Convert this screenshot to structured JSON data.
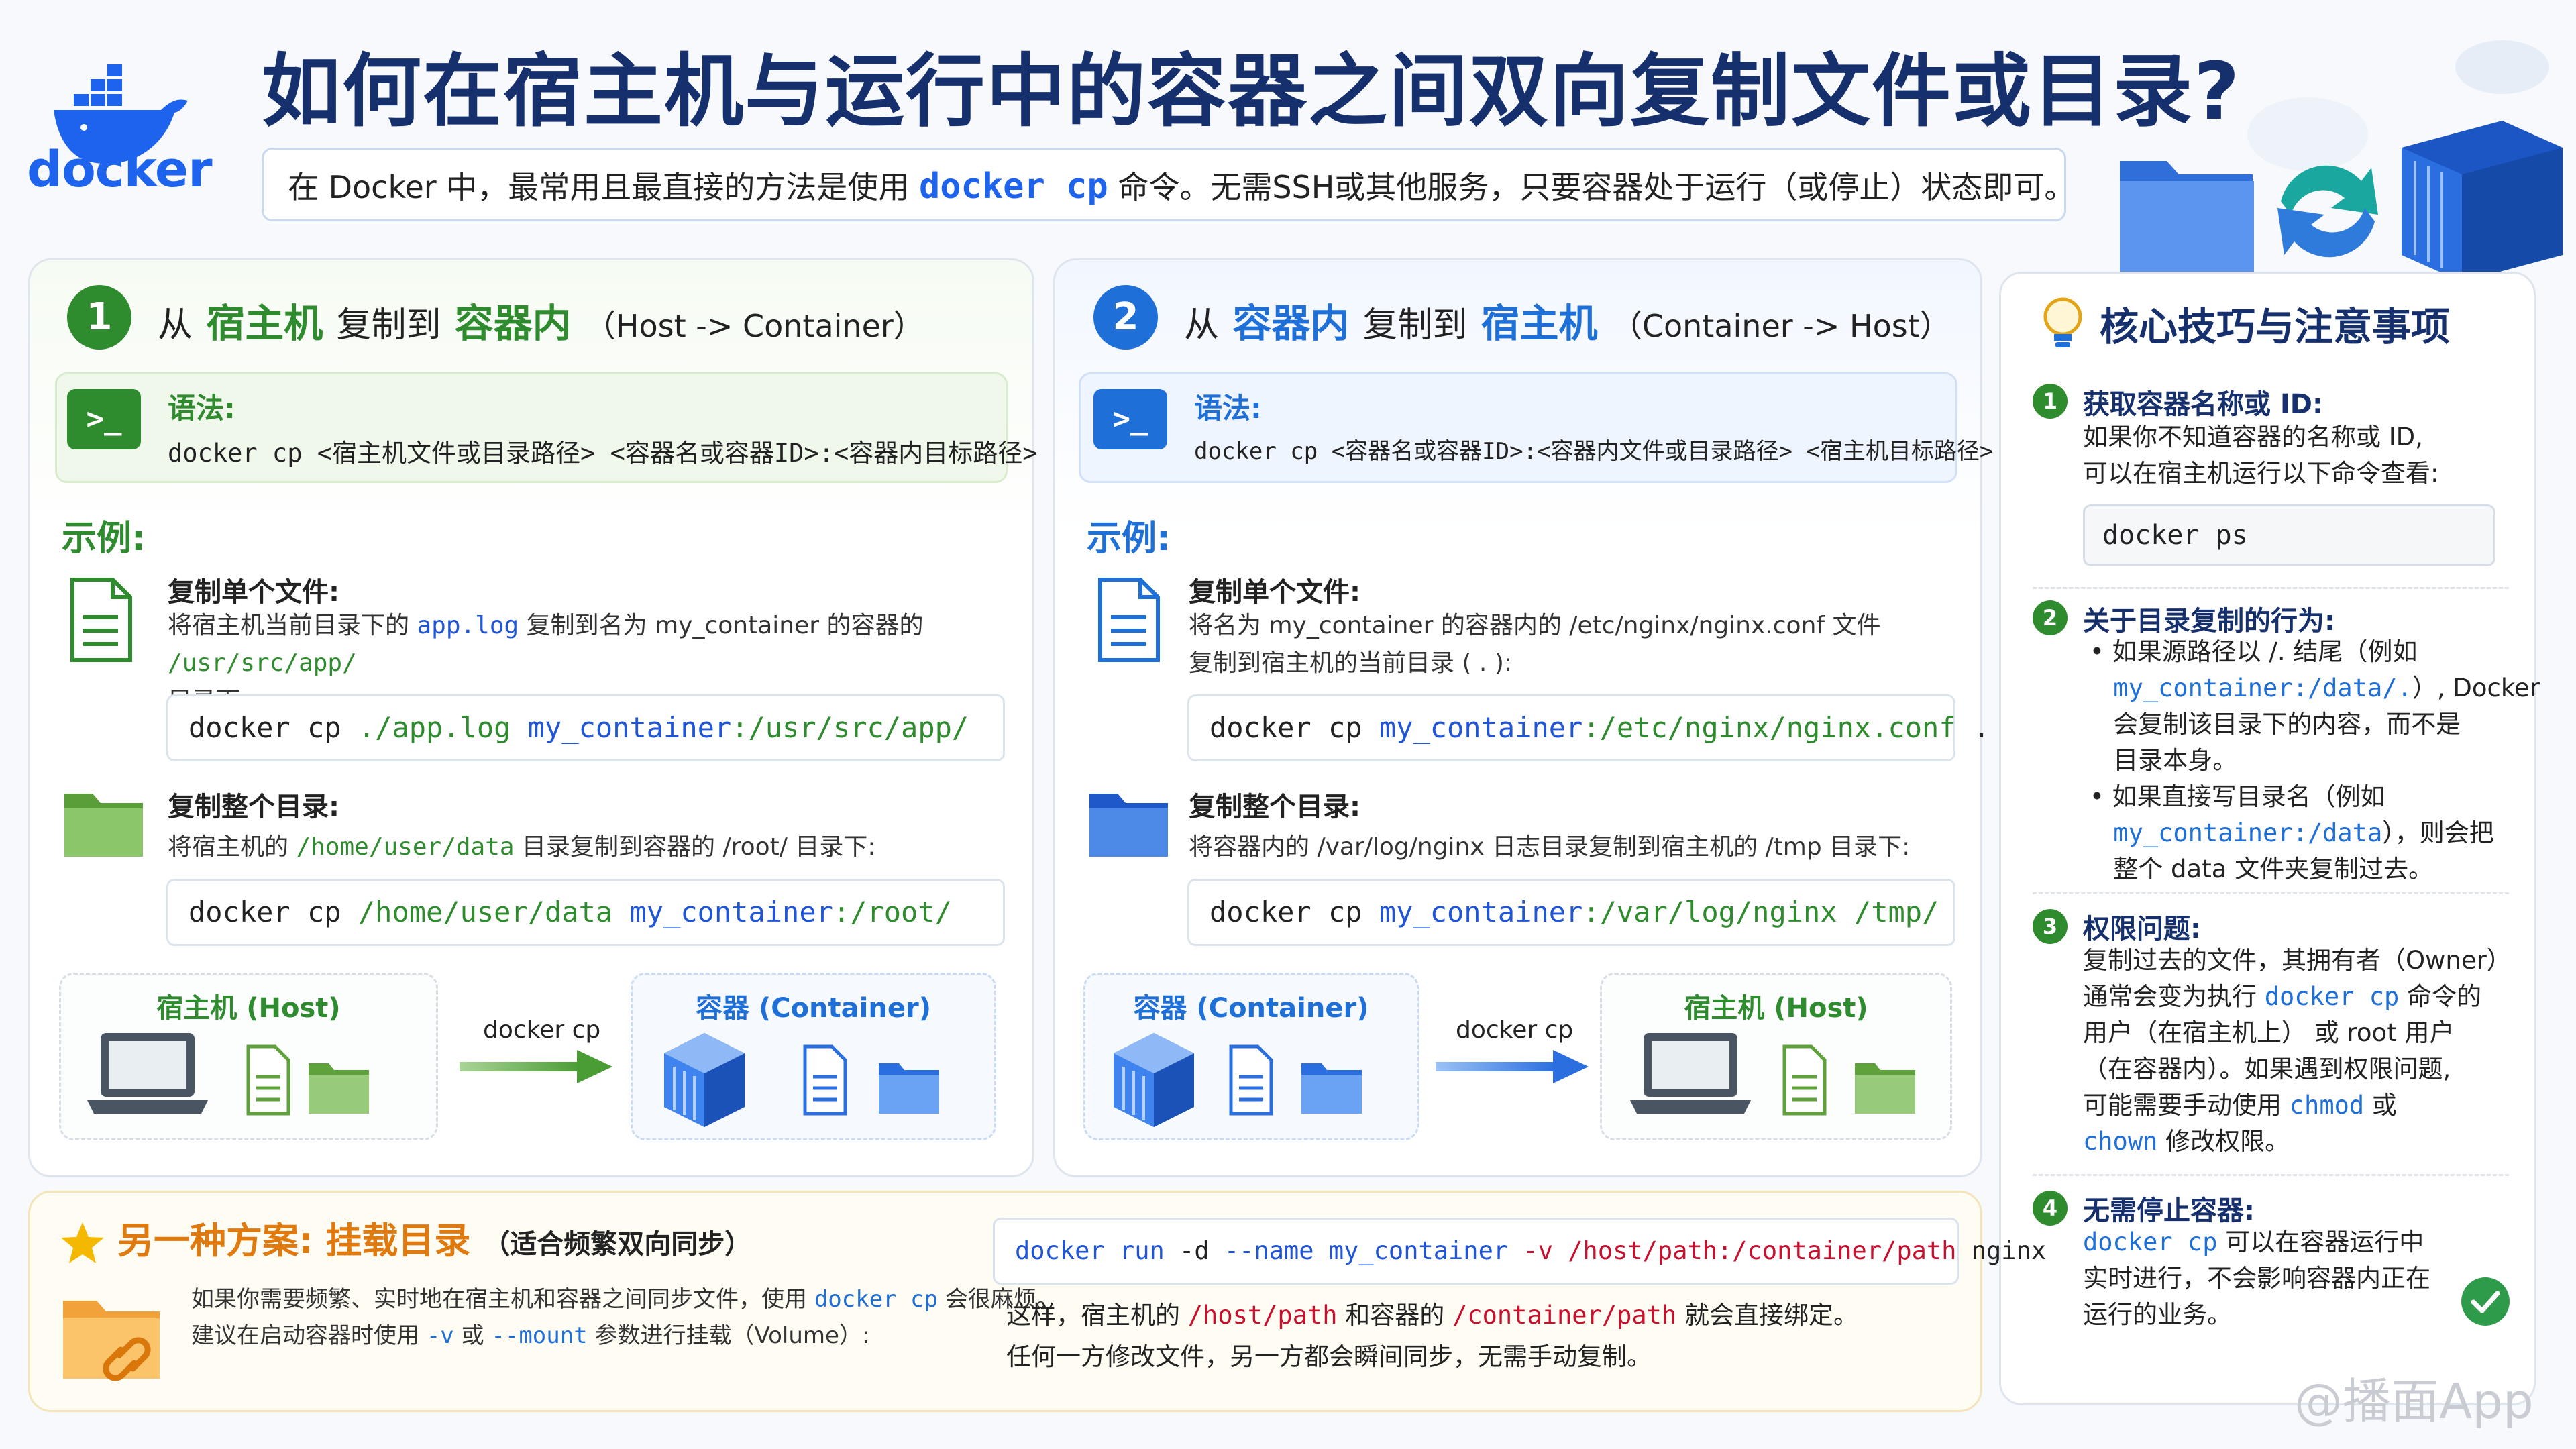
{
  "header": {
    "logo_text": "docker",
    "title": "如何在宿主机与运行中的容器之间双向复制文件或目录?",
    "intro_prefix": "在 Docker 中，最常用且最直接的方法是使用",
    "intro_cmd": "docker cp",
    "intro_suffix": "命令。无需SSH或其他服务，只要容器处于运行（或停止）状态即可。"
  },
  "section1": {
    "number": "1",
    "from": "从",
    "src": "宿主机",
    "copy_to": "复制到",
    "dst": "容器内",
    "direction": "（Host -> Container）",
    "syntax_label": "语法:",
    "syntax": "docker cp <宿主机文件或目录路径> <容器名或容器ID>:<容器内目标路径>",
    "examples_label": "示例:",
    "ex1_title": "复制单个文件:",
    "ex1_desc_a": "将宿主机当前目录下的",
    "ex1_desc_file": "app.log",
    "ex1_desc_b": "复制到名为 my_container 的容器的",
    "ex1_desc_path": "/usr/src/app/",
    "ex1_desc_c": "目录下:",
    "ex1_cmd_a": "docker cp",
    "ex1_cmd_b": "./app.log",
    "ex1_cmd_c": "my_container",
    "ex1_cmd_d": ":/usr/src/app/",
    "ex2_title": "复制整个目录:",
    "ex2_desc_a": "将宿主机的",
    "ex2_desc_path": "/home/user/data",
    "ex2_desc_b": "目录复制到容器的 /root/ 目录下:",
    "ex2_cmd_a": "docker cp",
    "ex2_cmd_b": "/home/user/data",
    "ex2_cmd_c": "my_container",
    "ex2_cmd_d": ":/root/",
    "flow_left": "宿主机 (Host)",
    "flow_label": "docker cp",
    "flow_right": "容器 (Container)"
  },
  "section2": {
    "number": "2",
    "from": "从",
    "src": "容器内",
    "copy_to": "复制到",
    "dst": "宿主机",
    "direction": "（Container -> Host）",
    "syntax_label": "语法:",
    "syntax": "docker cp <容器名或容器ID>:<容器内文件或目录路径> <宿主机目标路径>",
    "examples_label": "示例:",
    "ex1_title": "复制单个文件:",
    "ex1_desc_a": "将名为 my_container 的容器内的 /etc/nginx/nginx.conf 文件",
    "ex1_desc_b": "复制到宿主机的当前目录 ( . ):",
    "ex1_cmd_a": "docker cp",
    "ex1_cmd_b": "my_container",
    "ex1_cmd_c": ":/etc/nginx/nginx.conf",
    "ex1_cmd_d": ".",
    "ex2_title": "复制整个目录:",
    "ex2_desc": "将容器内的 /var/log/nginx 日志目录复制到宿主机的 /tmp 目录下:",
    "ex2_cmd_a": "docker cp",
    "ex2_cmd_b": "my_container",
    "ex2_cmd_c": ":/var/log/nginx",
    "ex2_cmd_d": "/tmp/",
    "flow_left": "容器 (Container)",
    "flow_label": "docker cp",
    "flow_right": "宿主机 (Host)"
  },
  "tips": {
    "title": "核心技巧与注意事项",
    "t1_num": "1",
    "t1_title": "获取容器名称或 ID:",
    "t1_line1": "如果你不知道容器的名称或 ID,",
    "t1_line2": "可以在宿主机运行以下命令查看:",
    "t1_cmd": "docker ps",
    "t2_num": "2",
    "t2_title": "关于目录复制的行为:",
    "t2_b1_a": "如果源路径以 /. 结尾（例如",
    "t2_b1_code": "my_container:/data/.",
    "t2_b1_b": "）, Docker",
    "t2_b1_c": "会复制该目录下的内容，而不是",
    "t2_b1_d": "目录本身。",
    "t2_b2_a": "如果直接写目录名（例如",
    "t2_b2_code": "my_container:/data",
    "t2_b2_b": "），则会把",
    "t2_b2_c": "整个 data 文件夹复制过去。",
    "t3_num": "3",
    "t3_title": "权限问题:",
    "t3_l1": "复制过去的文件，其拥有者（Owner）",
    "t3_l2_a": "通常会变为执行",
    "t3_l2_code": "docker cp",
    "t3_l2_b": "命令的",
    "t3_l3": "用户（在宿主机上） 或 root 用户",
    "t3_l4": "（在容器内）。如果遇到权限问题,",
    "t3_l5_a": "可能需要手动使用",
    "t3_l5_code": "chmod",
    "t3_l5_b": "或",
    "t3_l6_code": "chown",
    "t3_l6_b": "修改权限。",
    "t4_num": "4",
    "t4_title": "无需停止容器:",
    "t4_l1_code": "docker cp",
    "t4_l1_b": "可以在容器运行中",
    "t4_l2": "实时进行，不会影响容器内正在",
    "t4_l3": "运行的业务。"
  },
  "alt": {
    "title": "另一种方案: 挂载目录",
    "subtitle": "（适合频繁双向同步）",
    "desc1_a": "如果你需要频繁、实时地在宿主机和容器之间同步文件，使用",
    "desc1_code": "docker cp",
    "desc1_b": "会很麻烦。",
    "desc2_a": "建议在启动容器时使用",
    "desc2_v": "-v",
    "desc2_or": "或",
    "desc2_mount": "--mount",
    "desc2_b": "参数进行挂载（Volume）:",
    "cmd_a": "docker run",
    "cmd_b": "-d",
    "cmd_c": "--name",
    "cmd_d": "my_container",
    "cmd_e": "-v",
    "cmd_f": "/host/path:/container/path",
    "cmd_g": "nginx",
    "r1_a": "这样，宿主机的",
    "r1_p1": "/host/path",
    "r1_b": "和容器的",
    "r1_p2": "/container/path",
    "r1_c": "就会直接绑定。",
    "r2": "任何一方修改文件，另一方都会瞬间同步，无需手动复制。"
  },
  "watermark": "@播面App",
  "colors": {
    "green": "#2e8b2e",
    "blue": "#1f6fd8",
    "title": "#16306e",
    "orange": "#e07a0e",
    "red": "#c8102e"
  }
}
